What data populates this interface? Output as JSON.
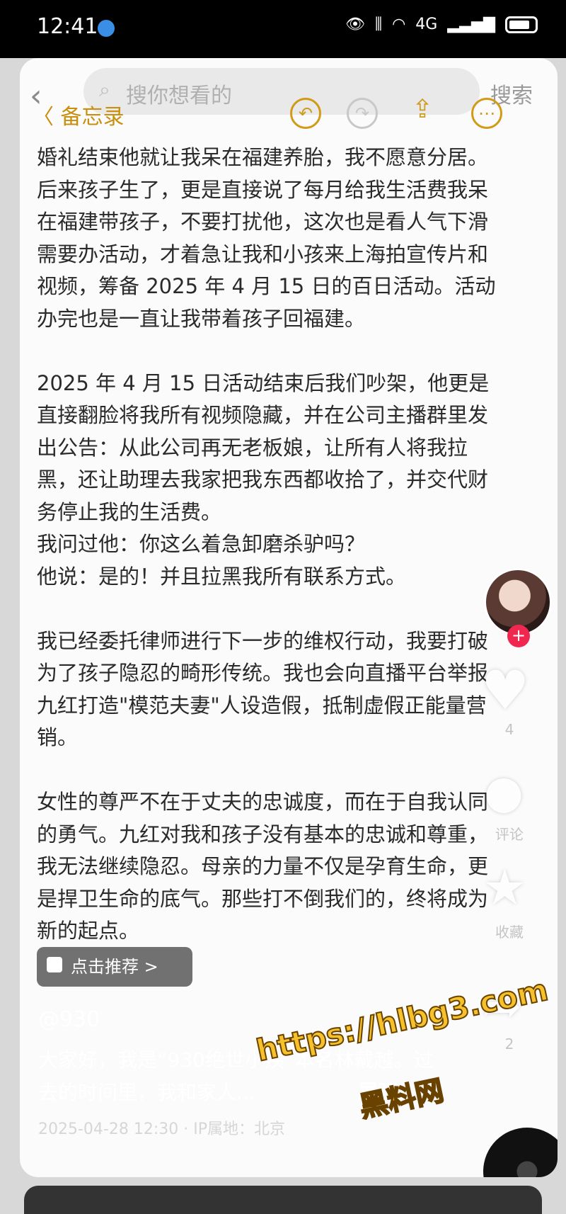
{
  "status_bar": {
    "time": "12:41",
    "network": "4G"
  },
  "search_ghost": {
    "placeholder": "搜你想看的",
    "button": "搜索"
  },
  "notes_app": {
    "back_label": "备忘录"
  },
  "note": {
    "paragraphs": [
      "婚礼结束他就让我呆在福建养胎，我不愿意分居。后来孩子生了，更是直接说了每月给我生活费我呆在福建带孩子，不要打扰他，这次也是看人气下滑需要办活动，才着急让我和小孩来上海拍宣传片和视频，筹备 2025 年 4 月 15 日的百日活动。活动办完也是一直让我带着孩子回福建。",
      "2025 年 4 月 15 日活动结束后我们吵架，他更是直接翻脸将我所有视频隐藏，并在公司主播群里发出公告：从此公司再无老板娘，让所有人将我拉黑，还让助理去我家把我东西都收拾了，并交代财务停止我的生活费。\n我问过他：你这么着急卸磨杀驴吗？\n他说：是的！并且拉黑我所有联系方式。",
      "我已经委托律师进行下一步的维权行动，我要打破为了孩子隐忍的畸形传统。我也会向直播平台举报九红打造\"模范夫妻\"人设造假，抵制虚假正能量营销。",
      "女性的尊严不在于丈夫的忠诚度，而在于自我认同的勇气。九红对我和孩子没有基本的忠诚和尊重，我无法继续隐忍。母亲的力量不仅是孕育生命，更是捍卫生命的底气。那些打不倒我们的，终将成为新的起点。"
    ]
  },
  "side_actions": {
    "like_count": "4",
    "comment_label": "评论",
    "favorite_label": "收藏",
    "share_count": "2"
  },
  "recommend_button": "点击推荐 >",
  "author": "@930",
  "description": "大家好，我是“930绝世小姨”本名林戴越。过去的时间里，我和家人...",
  "expand_label": "展开",
  "post_meta": "2025-04-28 12:30 · IP属地：北京",
  "watermark": {
    "url": "https://hlbg3.com",
    "text": "黑料网"
  }
}
